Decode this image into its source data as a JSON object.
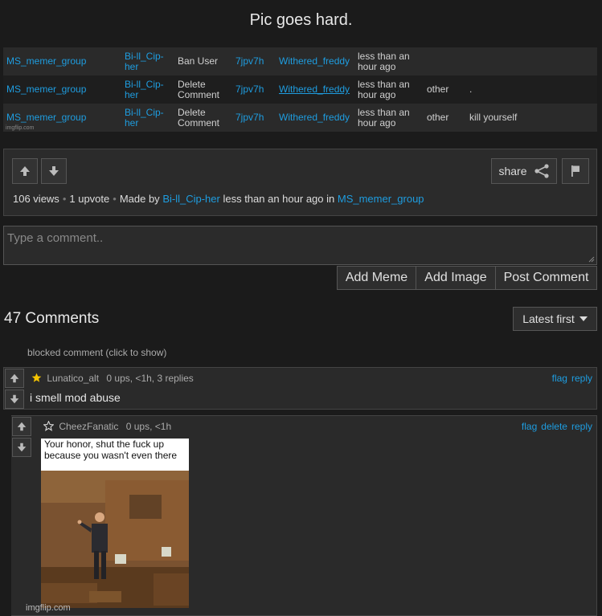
{
  "header": {
    "title": "Pic goes hard."
  },
  "mod_log": {
    "rows": [
      {
        "group": "MS_memer_group",
        "mod": "Bi-ll_Cip-her",
        "action": "Ban User",
        "id": "7jpv7h",
        "user": "Withered_freddy",
        "time": "less than an hour ago",
        "reason": "",
        "note": ""
      },
      {
        "group": "MS_memer_group",
        "mod": "Bi-ll_Cip-her",
        "action": "Delete Comment",
        "id": "7jpv7h",
        "user": "Withered_freddy",
        "time": "less than an hour ago",
        "reason": "other",
        "note": "."
      },
      {
        "group": "MS_memer_group",
        "mod": "Bi-ll_Cip-her",
        "action": "Delete Comment",
        "id": "7jpv7h",
        "user": "Withered_freddy",
        "time": "less than an hour ago",
        "reason": "other",
        "note": "kill yourself"
      }
    ],
    "watermark": "imgflip.com"
  },
  "post": {
    "share_label": "share",
    "views": "106 views",
    "upvotes": "1 upvote",
    "made_by_prefix": "Made by",
    "author": "Bi-ll_Cip-her",
    "time": "less than an hour ago in",
    "stream": "MS_memer_group"
  },
  "comment_form": {
    "placeholder": "Type a comment..",
    "add_meme": "Add Meme",
    "add_image": "Add Image",
    "post_comment": "Post Comment"
  },
  "comments_section": {
    "count_label": "47 Comments",
    "sort_label": "Latest first",
    "blocked": "blocked comment (click to show)"
  },
  "comments": [
    {
      "user": "Lunatico_alt",
      "meta": "0 ups, <1h, 3 replies",
      "text": "i smell mod abuse",
      "flag": "flag",
      "reply": "reply"
    },
    {
      "user": "CheezFanatic",
      "meta": "0 ups, <1h",
      "flag": "flag",
      "delete": "delete",
      "reply": "reply",
      "meme_caption": "Your honor, shut the fuck up because you wasn't even there"
    }
  ],
  "footer": {
    "watermark": "imgflip.com"
  },
  "colors": {
    "link": "#1e9de0",
    "accent_bar": "#e07b16",
    "background": "#1b1b1b"
  }
}
